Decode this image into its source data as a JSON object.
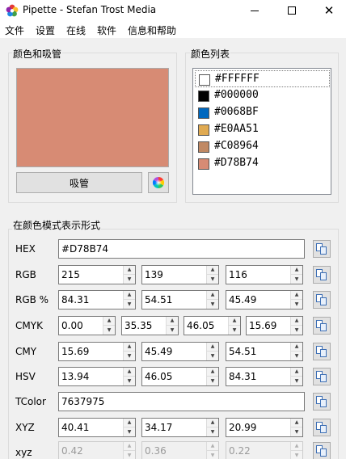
{
  "window": {
    "title": "Pipette - Stefan Trost Media",
    "icon": "app-flower-icon",
    "controls": [
      "minimize-icon",
      "maximize-icon",
      "close-icon"
    ]
  },
  "menu": [
    "文件",
    "设置",
    "在线",
    "软件",
    "信息和帮助"
  ],
  "color_group": {
    "title": "颜色和吸管",
    "current_color": "#D78B74",
    "pick_label": "吸管"
  },
  "list_group": {
    "title": "颜色列表",
    "items": [
      {
        "hex": "#FFFFFF",
        "color": "#FFFFFF"
      },
      {
        "hex": "#000000",
        "color": "#000000"
      },
      {
        "hex": "#0068BF",
        "color": "#0068BF"
      },
      {
        "hex": "#E0AA51",
        "color": "#E0AA51"
      },
      {
        "hex": "#C08964",
        "color": "#C08964"
      },
      {
        "hex": "#D78B74",
        "color": "#D78B74"
      }
    ]
  },
  "modes_group": {
    "title": "在颜色模式表示形式",
    "rows": {
      "hex": {
        "label": "HEX",
        "value": "#D78B74"
      },
      "rgb": {
        "label": "RGB",
        "values": [
          "215",
          "139",
          "116"
        ]
      },
      "rgb_pct": {
        "label": "RGB %",
        "values": [
          "84.31",
          "54.51",
          "45.49"
        ]
      },
      "cmyk": {
        "label": "CMYK",
        "values": [
          "0.00",
          "35.35",
          "46.05",
          "15.69"
        ]
      },
      "cmy": {
        "label": "CMY",
        "values": [
          "15.69",
          "45.49",
          "54.51"
        ]
      },
      "hsv": {
        "label": "HSV",
        "values": [
          "13.94",
          "46.05",
          "84.31"
        ]
      },
      "tcolor": {
        "label": "TColor",
        "value": "7637975"
      },
      "xyz": {
        "label": "XYZ",
        "values": [
          "40.41",
          "34.17",
          "20.99"
        ]
      },
      "xyz_norm": {
        "label": "xyz",
        "values": [
          "0.42",
          "0.36",
          "0.22"
        ]
      }
    }
  }
}
